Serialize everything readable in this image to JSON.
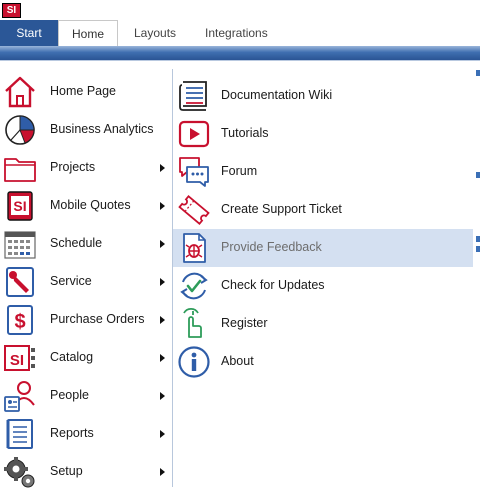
{
  "app": {
    "logo_text": "SI"
  },
  "tabs": [
    {
      "label": "Start"
    },
    {
      "label": "Home"
    },
    {
      "label": "Layouts"
    },
    {
      "label": "Integrations"
    }
  ],
  "menu": {
    "left_items": [
      {
        "label": "Home Page",
        "icon": "home-icon",
        "submenu": false
      },
      {
        "label": "Business Analytics",
        "icon": "pie-chart-icon",
        "submenu": false
      },
      {
        "label": "Projects",
        "icon": "folder-icon",
        "submenu": true
      },
      {
        "label": "Mobile Quotes",
        "icon": "si-logo-icon",
        "submenu": true
      },
      {
        "label": "Schedule",
        "icon": "calendar-icon",
        "submenu": true
      },
      {
        "label": "Service",
        "icon": "wrench-icon",
        "submenu": true
      },
      {
        "label": "Purchase Orders",
        "icon": "dollar-document-icon",
        "submenu": true
      },
      {
        "label": "Catalog",
        "icon": "catalog-icon",
        "submenu": true
      },
      {
        "label": "People",
        "icon": "people-icon",
        "submenu": true
      },
      {
        "label": "Reports",
        "icon": "report-icon",
        "submenu": true
      },
      {
        "label": "Setup",
        "icon": "gears-icon",
        "submenu": true
      }
    ],
    "right_items": [
      {
        "label": "Documentation Wiki",
        "icon": "documentation-icon"
      },
      {
        "label": "Tutorials",
        "icon": "play-icon"
      },
      {
        "label": "Forum",
        "icon": "chat-bubble-icon"
      },
      {
        "label": "Create Support Ticket",
        "icon": "ticket-icon"
      },
      {
        "label": "Provide Feedback",
        "icon": "bug-report-icon",
        "highlighted": true
      },
      {
        "label": "Check for Updates",
        "icon": "refresh-check-icon"
      },
      {
        "label": "Register",
        "icon": "hand-pointer-icon"
      },
      {
        "label": "About",
        "icon": "info-icon"
      }
    ]
  },
  "colors": {
    "accent": "#2b5797",
    "brand_red": "#c8102e",
    "highlight": "#d4e0f1",
    "icon_blue": "#2f5da8",
    "icon_green": "#2e9c5a"
  }
}
